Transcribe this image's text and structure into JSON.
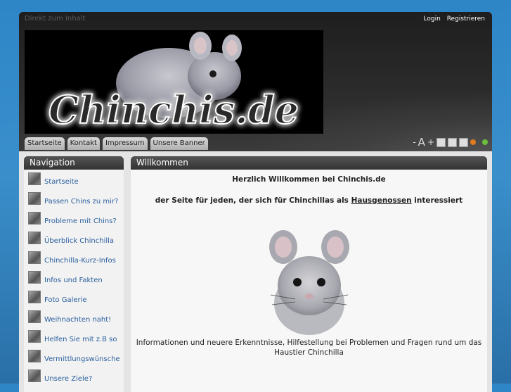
{
  "skip_link": "Direkt zum Inhalt",
  "top_links": {
    "login": "Login",
    "register": "Registrieren"
  },
  "tabs": [
    "Startseite",
    "Kontakt",
    "Impressum",
    "Unsere Banner"
  ],
  "tools": {
    "decrease": "-",
    "reset": "A",
    "increase": "+"
  },
  "tool_colors": {
    "orange": "#e07b1f",
    "green": "#6cbf3a"
  },
  "banner_text": "Chinchis.de",
  "sidebar": {
    "title": "Navigation",
    "items": [
      "Startseite",
      "Passen Chins zu mir?",
      "Probleme mit Chins?",
      "Überblick Chinchilla",
      "Chinchilla-Kurz-Infos",
      "Infos und Fakten",
      "Foto Galerie",
      "Weihnachten naht!",
      "Helfen Sie mit z.B so",
      "Vermittlungswünsche",
      "Unsere Ziele?"
    ]
  },
  "main": {
    "title": "Willkommen",
    "heading": "Herzlich Willkommen bei Chinchis.de",
    "sub_before": "der Seite für jeden, der sich für Chinchillas als ",
    "sub_link": "Hausgenossen",
    "sub_after": " interessiert",
    "info_line1": "Informationen und neuere Erkenntnisse, Hilfestellung bei Problemen und Fragen rund um das",
    "info_line2": "Haustier Chinchilla"
  }
}
